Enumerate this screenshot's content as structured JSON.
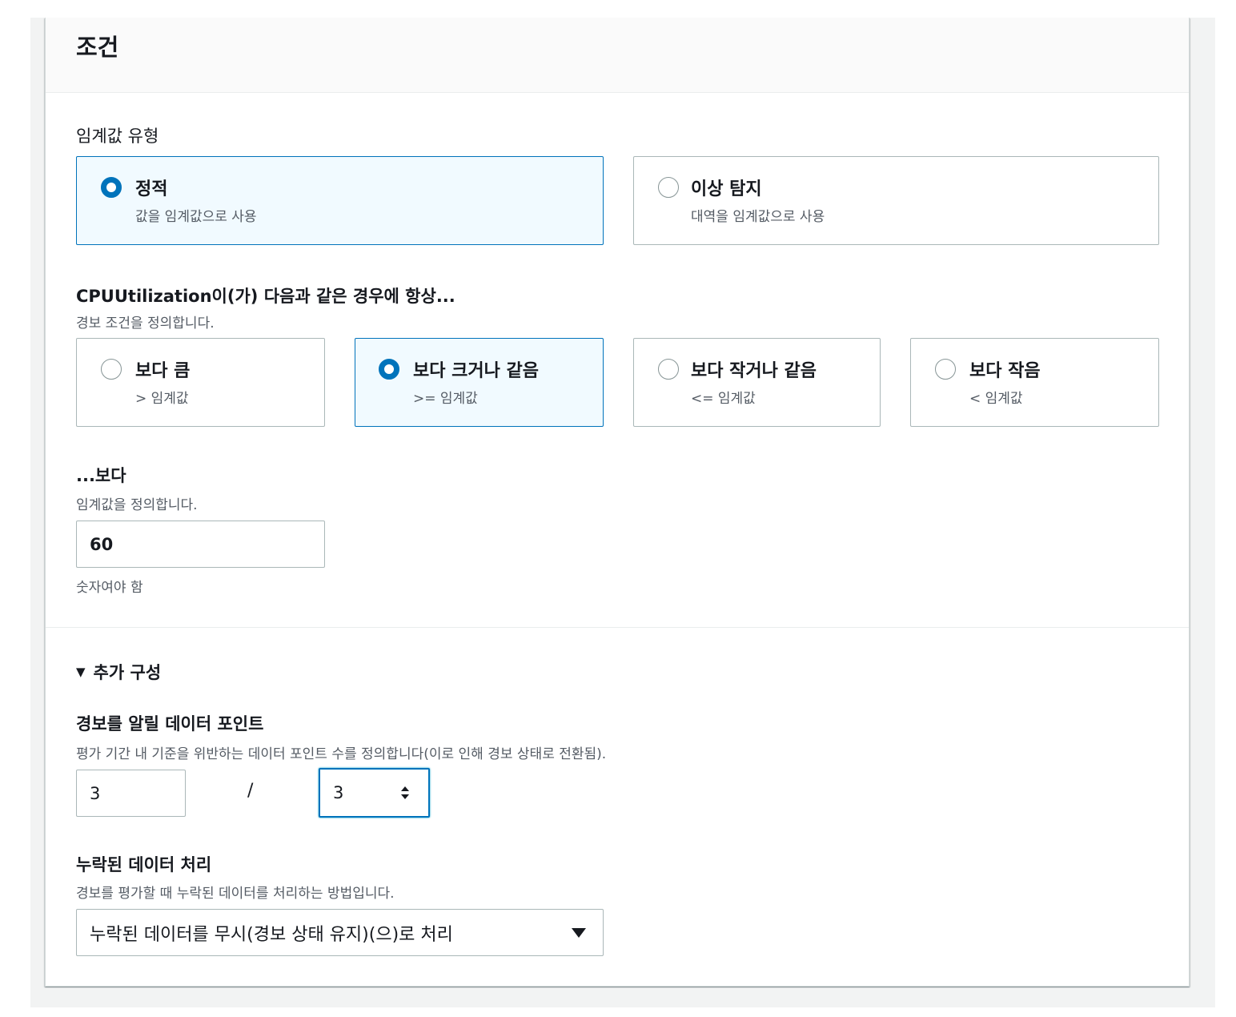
{
  "panel": {
    "title": "조건"
  },
  "threshold_type": {
    "label": "임계값 유형",
    "options": [
      {
        "title": "정적",
        "sub": "값을 임계값으로 사용",
        "selected": true
      },
      {
        "title": "이상 탐지",
        "sub": "대역을 임계값으로 사용",
        "selected": false
      }
    ]
  },
  "condition": {
    "label": "CPUUtilization이(가) 다음과 같은 경우에 항상...",
    "desc": "경보 조건을 정의합니다.",
    "options": [
      {
        "title": "보다 큼",
        "sub": "> 임계값",
        "selected": false
      },
      {
        "title": "보다 크거나 같음",
        "sub": ">= 임계값",
        "selected": true
      },
      {
        "title": "보다 작거나 같음",
        "sub": "<= 임계값",
        "selected": false
      },
      {
        "title": "보다 작음",
        "sub": "< 임계값",
        "selected": false
      }
    ]
  },
  "threshold": {
    "label": "...보다",
    "desc": "임계값을 정의합니다.",
    "value": "60",
    "constraint": "숫자여야 함"
  },
  "additional": {
    "toggle_icon": "▼",
    "toggle_label": "추가 구성",
    "datapoints": {
      "label": "경보를 알릴 데이터 포인트",
      "desc": "평가 기간 내 기준을 위반하는 데이터 포인트 수를 정의합니다(이로 인해 경보 상태로 전환됨).",
      "value_a": "3",
      "separator": "/",
      "value_b": "3"
    },
    "missing_data": {
      "label": "누락된 데이터 처리",
      "desc": "경보를 평가할 때 누락된 데이터를 처리하는 방법입니다.",
      "selected": "누락된 데이터를 무시(경보 상태 유지)(으)로 처리"
    }
  },
  "colors": {
    "accent": "#0073bb",
    "selected_bg": "#f1faff",
    "border": "#aab7b8",
    "muted_text": "#545b64"
  }
}
